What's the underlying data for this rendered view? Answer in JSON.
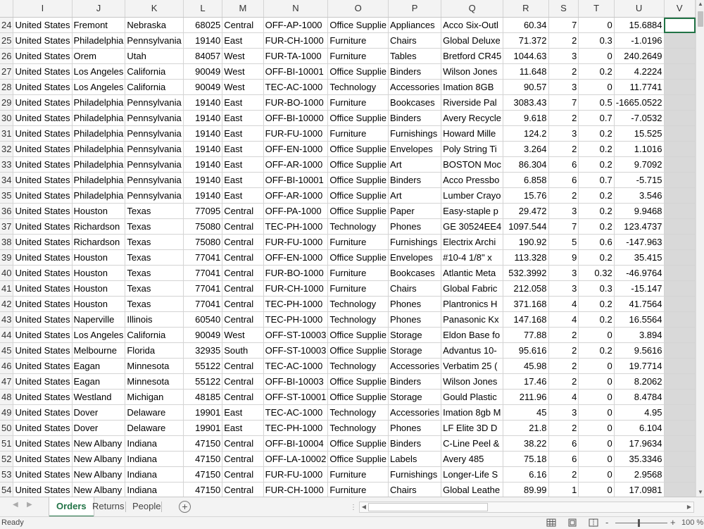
{
  "columns": [
    "I",
    "J",
    "K",
    "L",
    "M",
    "N",
    "O",
    "P",
    "Q",
    "R",
    "S",
    "T",
    "U",
    "V"
  ],
  "rows": [
    {
      "n": "24",
      "c": [
        "United States",
        "Fremont",
        "Nebraska",
        "68025",
        "Central",
        "OFF-AP-1000",
        "Office Supplie",
        "Appliances",
        "Acco Six-Outl",
        "60.34",
        "7",
        "0",
        "15.6884"
      ]
    },
    {
      "n": "25",
      "c": [
        "United States",
        "Philadelphia",
        "Pennsylvania",
        "19140",
        "East",
        "FUR-CH-1000",
        "Furniture",
        "Chairs",
        "Global Deluxe",
        "71.372",
        "2",
        "0.3",
        "-1.0196"
      ]
    },
    {
      "n": "26",
      "c": [
        "United States",
        "Orem",
        "Utah",
        "84057",
        "West",
        "FUR-TA-1000",
        "Furniture",
        "Tables",
        "Bretford CR45",
        "1044.63",
        "3",
        "0",
        "240.2649"
      ]
    },
    {
      "n": "27",
      "c": [
        "United States",
        "Los Angeles",
        "California",
        "90049",
        "West",
        "OFF-BI-10001",
        "Office Supplie",
        "Binders",
        "Wilson Jones",
        "11.648",
        "2",
        "0.2",
        "4.2224"
      ]
    },
    {
      "n": "28",
      "c": [
        "United States",
        "Los Angeles",
        "California",
        "90049",
        "West",
        "TEC-AC-1000",
        "Technology",
        "Accessories",
        "Imation 8GB",
        "90.57",
        "3",
        "0",
        "11.7741"
      ]
    },
    {
      "n": "29",
      "c": [
        "United States",
        "Philadelphia",
        "Pennsylvania",
        "19140",
        "East",
        "FUR-BO-1000",
        "Furniture",
        "Bookcases",
        "Riverside Pal",
        "3083.43",
        "7",
        "0.5",
        "-1665.0522"
      ]
    },
    {
      "n": "30",
      "c": [
        "United States",
        "Philadelphia",
        "Pennsylvania",
        "19140",
        "East",
        "OFF-BI-10000",
        "Office Supplie",
        "Binders",
        "Avery Recycle",
        "9.618",
        "2",
        "0.7",
        "-7.0532"
      ]
    },
    {
      "n": "31",
      "c": [
        "United States",
        "Philadelphia",
        "Pennsylvania",
        "19140",
        "East",
        "FUR-FU-1000",
        "Furniture",
        "Furnishings",
        "Howard Mille",
        "124.2",
        "3",
        "0.2",
        "15.525"
      ]
    },
    {
      "n": "32",
      "c": [
        "United States",
        "Philadelphia",
        "Pennsylvania",
        "19140",
        "East",
        "OFF-EN-1000",
        "Office Supplie",
        "Envelopes",
        "Poly String Ti",
        "3.264",
        "2",
        "0.2",
        "1.1016"
      ]
    },
    {
      "n": "33",
      "c": [
        "United States",
        "Philadelphia",
        "Pennsylvania",
        "19140",
        "East",
        "OFF-AR-1000",
        "Office Supplie",
        "Art",
        "BOSTON Moc",
        "86.304",
        "6",
        "0.2",
        "9.7092"
      ]
    },
    {
      "n": "34",
      "c": [
        "United States",
        "Philadelphia",
        "Pennsylvania",
        "19140",
        "East",
        "OFF-BI-10001",
        "Office Supplie",
        "Binders",
        "Acco Pressbo",
        "6.858",
        "6",
        "0.7",
        "-5.715"
      ]
    },
    {
      "n": "35",
      "c": [
        "United States",
        "Philadelphia",
        "Pennsylvania",
        "19140",
        "East",
        "OFF-AR-1000",
        "Office Supplie",
        "Art",
        "Lumber Crayo",
        "15.76",
        "2",
        "0.2",
        "3.546"
      ]
    },
    {
      "n": "36",
      "c": [
        "United States",
        "Houston",
        "Texas",
        "77095",
        "Central",
        "OFF-PA-1000",
        "Office Supplie",
        "Paper",
        "Easy-staple p",
        "29.472",
        "3",
        "0.2",
        "9.9468"
      ]
    },
    {
      "n": "37",
      "c": [
        "United States",
        "Richardson",
        "Texas",
        "75080",
        "Central",
        "TEC-PH-1000",
        "Technology",
        "Phones",
        "GE 30524EE4",
        "1097.544",
        "7",
        "0.2",
        "123.4737"
      ]
    },
    {
      "n": "38",
      "c": [
        "United States",
        "Richardson",
        "Texas",
        "75080",
        "Central",
        "FUR-FU-1000",
        "Furniture",
        "Furnishings",
        "Electrix Archi",
        "190.92",
        "5",
        "0.6",
        "-147.963"
      ]
    },
    {
      "n": "39",
      "c": [
        "United States",
        "Houston",
        "Texas",
        "77041",
        "Central",
        "OFF-EN-1000",
        "Office Supplie",
        "Envelopes",
        "#10-4 1/8\" x",
        "113.328",
        "9",
        "0.2",
        "35.415"
      ]
    },
    {
      "n": "40",
      "c": [
        "United States",
        "Houston",
        "Texas",
        "77041",
        "Central",
        "FUR-BO-1000",
        "Furniture",
        "Bookcases",
        "Atlantic Meta",
        "532.3992",
        "3",
        "0.32",
        "-46.9764"
      ]
    },
    {
      "n": "41",
      "c": [
        "United States",
        "Houston",
        "Texas",
        "77041",
        "Central",
        "FUR-CH-1000",
        "Furniture",
        "Chairs",
        "Global Fabric",
        "212.058",
        "3",
        "0.3",
        "-15.147"
      ]
    },
    {
      "n": "42",
      "c": [
        "United States",
        "Houston",
        "Texas",
        "77041",
        "Central",
        "TEC-PH-1000",
        "Technology",
        "Phones",
        "Plantronics H",
        "371.168",
        "4",
        "0.2",
        "41.7564"
      ]
    },
    {
      "n": "43",
      "c": [
        "United States",
        "Naperville",
        "Illinois",
        "60540",
        "Central",
        "TEC-PH-1000",
        "Technology",
        "Phones",
        "Panasonic Kx",
        "147.168",
        "4",
        "0.2",
        "16.5564"
      ]
    },
    {
      "n": "44",
      "c": [
        "United States",
        "Los Angeles",
        "California",
        "90049",
        "West",
        "OFF-ST-10003",
        "Office Supplie",
        "Storage",
        "Eldon Base fo",
        "77.88",
        "2",
        "0",
        "3.894"
      ]
    },
    {
      "n": "45",
      "c": [
        "United States",
        "Melbourne",
        "Florida",
        "32935",
        "South",
        "OFF-ST-10003",
        "Office Supplie",
        "Storage",
        "Advantus 10-",
        "95.616",
        "2",
        "0.2",
        "9.5616"
      ]
    },
    {
      "n": "46",
      "c": [
        "United States",
        "Eagan",
        "Minnesota",
        "55122",
        "Central",
        "TEC-AC-1000",
        "Technology",
        "Accessories",
        "Verbatim 25 (",
        "45.98",
        "2",
        "0",
        "19.7714"
      ]
    },
    {
      "n": "47",
      "c": [
        "United States",
        "Eagan",
        "Minnesota",
        "55122",
        "Central",
        "OFF-BI-10003",
        "Office Supplie",
        "Binders",
        "Wilson Jones",
        "17.46",
        "2",
        "0",
        "8.2062"
      ]
    },
    {
      "n": "48",
      "c": [
        "United States",
        "Westland",
        "Michigan",
        "48185",
        "Central",
        "OFF-ST-10001",
        "Office Supplie",
        "Storage",
        "Gould Plastic",
        "211.96",
        "4",
        "0",
        "8.4784"
      ]
    },
    {
      "n": "49",
      "c": [
        "United States",
        "Dover",
        "Delaware",
        "19901",
        "East",
        "TEC-AC-1000",
        "Technology",
        "Accessories",
        "Imation 8gb M",
        "45",
        "3",
        "0",
        "4.95"
      ]
    },
    {
      "n": "50",
      "c": [
        "United States",
        "Dover",
        "Delaware",
        "19901",
        "East",
        "TEC-PH-1000",
        "Technology",
        "Phones",
        "LF Elite 3D D",
        "21.8",
        "2",
        "0",
        "6.104"
      ]
    },
    {
      "n": "51",
      "c": [
        "United States",
        "New Albany",
        "Indiana",
        "47150",
        "Central",
        "OFF-BI-10004",
        "Office Supplie",
        "Binders",
        "C-Line Peel &",
        "38.22",
        "6",
        "0",
        "17.9634"
      ]
    },
    {
      "n": "52",
      "c": [
        "United States",
        "New Albany",
        "Indiana",
        "47150",
        "Central",
        "OFF-LA-10002",
        "Office Supplie",
        "Labels",
        "Avery 485",
        "75.18",
        "6",
        "0",
        "35.3346"
      ]
    },
    {
      "n": "53",
      "c": [
        "United States",
        "New Albany",
        "Indiana",
        "47150",
        "Central",
        "FUR-FU-1000",
        "Furniture",
        "Furnishings",
        "Longer-Life S",
        "6.16",
        "2",
        "0",
        "2.9568"
      ]
    },
    {
      "n": "54",
      "c": [
        "United States",
        "New Albany",
        "Indiana",
        "47150",
        "Central",
        "FUR-CH-1000",
        "Furniture",
        "Chairs",
        "Global Leathe",
        "89.99",
        "1",
        "0",
        "17.0981"
      ]
    }
  ],
  "sheet_tabs": [
    "Orders",
    "Returns",
    "People"
  ],
  "active_tab": "Orders",
  "status": {
    "ready": "Ready",
    "zoom": "100 %",
    "zoom_minus": "-",
    "zoom_plus": "+"
  },
  "add_sheet_symbol": "+",
  "colors": {
    "accent": "#217346",
    "header_bg": "#f3f3f3",
    "grid": "#d4d4d4"
  },
  "icons": [
    "normal-view-icon",
    "page-layout-icon",
    "page-break-view-icon",
    "add-sheet-icon"
  ]
}
